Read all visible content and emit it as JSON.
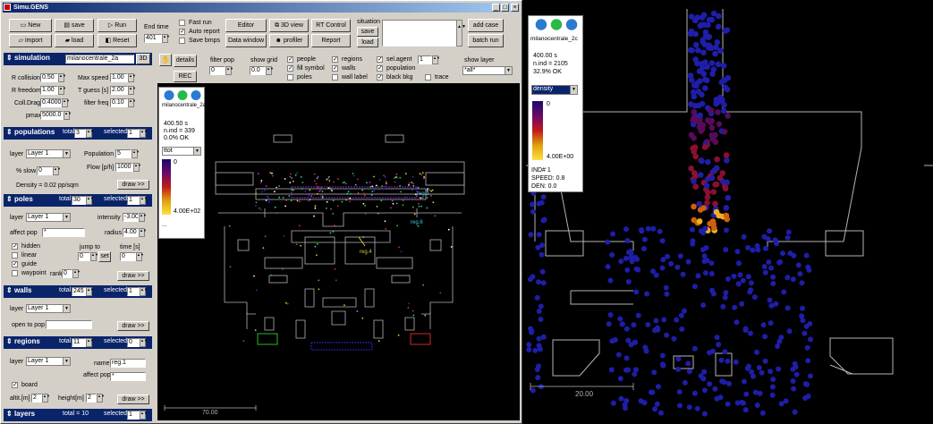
{
  "window": {
    "title": "Simu.GENS",
    "min": "_",
    "max": "□",
    "close": "×"
  },
  "toolbar": {
    "new": "New",
    "save": "save",
    "run": "Run",
    "import": "import",
    "load": "load",
    "reset": "Reset",
    "end_time_label": "End time",
    "end_time_value": "401",
    "fast_run": "Fast run",
    "auto_report": "Auto report",
    "save_bmps": "Save bmps",
    "editor": "Editor",
    "data_window": "Data window",
    "view3d": "3D view",
    "profiler": "profiler",
    "rt_control": "RT Control",
    "report": "Report",
    "situation_label": "situation",
    "situation_save": "save",
    "situation_load": "load",
    "add_case": "add case",
    "batch_run": "batch run"
  },
  "simulation": {
    "header": "simulation",
    "name": "milanocentrale_2a",
    "btn3d": "3D",
    "r_collision_label": "R collision",
    "r_collision": "0.50",
    "max_speed_label": "Max speed",
    "max_speed": "1.00",
    "r_freedom_label": "R freedom",
    "r_freedom": "1.00",
    "t_guess_label": "T guess [s]",
    "t_guess": "2.00",
    "coll_drag_label": "Coll.Drag",
    "coll_drag": "0.4000",
    "filter_freq_label": "filter freq",
    "filter_freq": "0.10",
    "pmax_label": "pmax",
    "pmax": "5000.0"
  },
  "populations": {
    "header": "populations",
    "total_label": "total",
    "total": "3",
    "selected_label": "selected",
    "selected": "1",
    "layer_label": "layer",
    "layer": "Layer 1",
    "population_label": "Population",
    "population": "5",
    "slow_label": "% slow",
    "slow": "0",
    "flow_label": "Flow [p/h]",
    "flow": "1000",
    "density": "Density = 0.02 pp/sqm",
    "draw": "draw >>"
  },
  "poles": {
    "header": "poles",
    "total_label": "total",
    "total": "30",
    "selected_label": "selected",
    "selected": "1",
    "layer_label": "layer",
    "layer": "Layer 1",
    "intensity_label": "intensity",
    "intensity": "-3.00",
    "affect_pop_label": "affect pop",
    "affect_pop": "*",
    "radius_label": "radius",
    "radius": "4.00",
    "hidden": "hidden",
    "linear": "linear",
    "guide": "guide",
    "waypoint": "waypoint",
    "rank_label": "rank",
    "rank": "0",
    "jump_to_label": "jump to",
    "jump_to": "0",
    "set": "set",
    "time_label": "time [s]",
    "time": "0",
    "draw": "draw >>"
  },
  "walls": {
    "header": "walls",
    "total_label": "total",
    "total": "245",
    "selected_label": "selected",
    "selected": "1",
    "layer_label": "layer",
    "layer": "Layer 1",
    "open_to_pop_label": "open to pop",
    "open_to_pop": "",
    "draw": "draw >>"
  },
  "regions": {
    "header": "regions",
    "total_label": "total",
    "total": "11",
    "selected_label": "selected",
    "selected": "0",
    "layer_label": "layer",
    "layer": "Layer 1",
    "name_label": "name",
    "name": "reg.1",
    "affect_pop_label": "affect pop",
    "affect_pop": "*",
    "board": "board",
    "altit_label": "altit.[m]",
    "altit": "2",
    "height_label": "height[m]",
    "height": "2",
    "draw": "draw >>"
  },
  "layers": {
    "header": "layers",
    "total_text": "total = 10",
    "selected_label": "selected",
    "selected": "1"
  },
  "display": {
    "details": "details",
    "rec": "REC",
    "filter_pop_label": "filter pop",
    "filter_pop": "0",
    "show_grid_label": "show grid",
    "show_grid": "0.0",
    "people": "people",
    "fill_symbol": "fill symbol",
    "poles": "poles",
    "regions": "regions",
    "walls": "walls",
    "wall_label": "wall label",
    "sel_agent": "sel.agent",
    "sel_agent_value": "1",
    "population": "population",
    "black_bkg": "black bkg",
    "trace": "trace",
    "show_layer_label": "show layer",
    "show_layer": "*all*"
  },
  "left_overlay": {
    "name": "milanocentrale_2a",
    "time": "400.50 s",
    "n_ind": "n.ind = 339",
    "ok": "0.0% OK",
    "mode": "ttot",
    "min": "0",
    "max": "4.00E+02",
    "dots": "..."
  },
  "left_canvas": {
    "scale": "70.00",
    "labels": [
      "reg.3",
      "reg.6",
      "reg.4"
    ]
  },
  "right_overlay": {
    "name": "milanocentrale_2c",
    "time": "400.00 s",
    "n_ind": "n.ind = 2105",
    "ok": "32.9% OK",
    "mode": "density",
    "min": "0",
    "max": "4.00E+00",
    "ind": "IND# 1",
    "speed": "SPEED: 0.8",
    "den": "DEN: 0.0"
  },
  "right_canvas": {
    "scale": "20.00"
  },
  "colors": {
    "accent": "#0a246a",
    "panel": "#d4d0c8",
    "agent_blue": "#1e1ea8",
    "wall": "#b4b4b4"
  }
}
